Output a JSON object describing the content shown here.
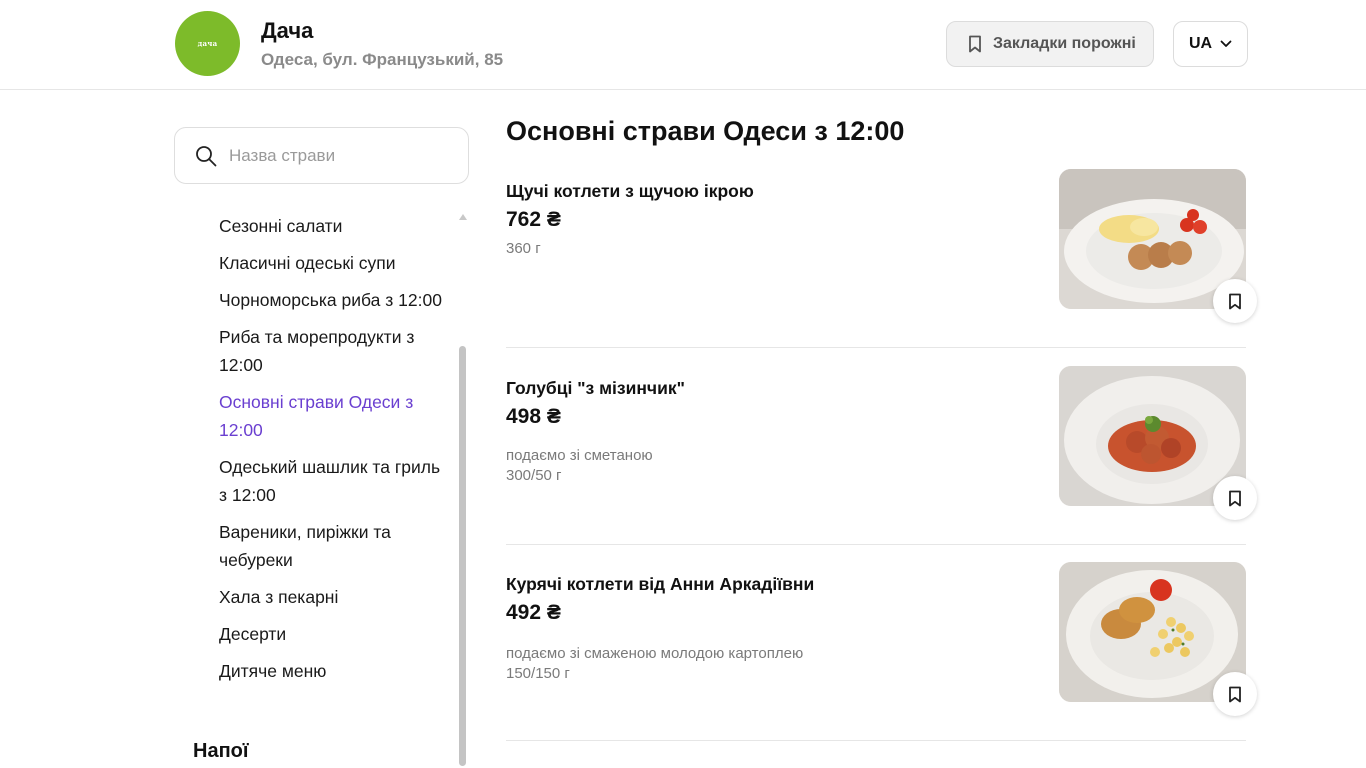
{
  "header": {
    "logo_text": "дача",
    "restaurant_name": "Дача",
    "restaurant_address": "Одеса, бул. Французький, 85",
    "bookmarks_label": "Закладки порожні",
    "language": "UA"
  },
  "sidebar": {
    "search_placeholder": "Назва страви",
    "categories": [
      {
        "label": "Сезонні салати"
      },
      {
        "label": "Класичні одеські супи"
      },
      {
        "label": "Чорноморська риба з 12:00"
      },
      {
        "label": "Риба та морепродукти з 12:00"
      },
      {
        "label": "Основні страви Одеси з 12:00"
      },
      {
        "label": "Одеський шашлик та гриль з 12:00"
      },
      {
        "label": "Вареники, пиріжки та чебуреки"
      },
      {
        "label": "Хала з пекарні"
      },
      {
        "label": "Десерти"
      },
      {
        "label": "Дитяче меню"
      }
    ],
    "active_category": "Основні страви Одеси з 12:00",
    "next_section": "Напої"
  },
  "main": {
    "title": "Основні страви Одеси з 12:00",
    "dishes": [
      {
        "name": "Щучі котлети з щучою ікрою",
        "price": "762 ₴",
        "description": "",
        "weight": "360 г"
      },
      {
        "name": "Голубці \"з мізинчик\"",
        "price": "498 ₴",
        "description": "подаємо зі сметаною",
        "weight": "300/50 г"
      },
      {
        "name": "Курячі котлети від Анни Аркадіївни",
        "price": "492 ₴",
        "description": "подаємо зі смаженою молодою картоплею",
        "weight": "150/150 г"
      }
    ]
  },
  "colors": {
    "logo_green": "#7dbb2a",
    "active_purple": "#6a3fd0",
    "muted_text": "#7a7a7a"
  }
}
